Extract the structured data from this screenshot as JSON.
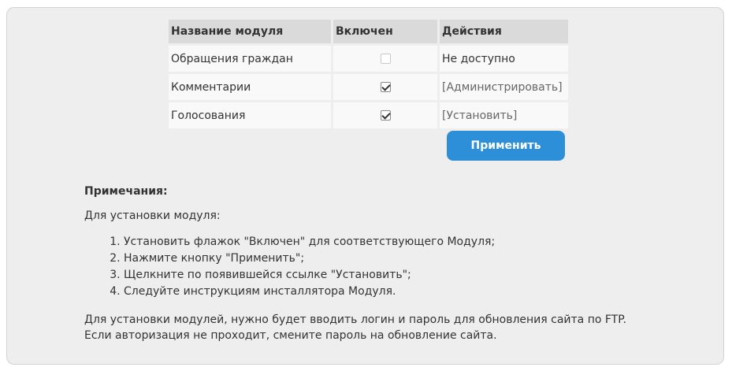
{
  "table": {
    "headers": [
      "Название модуля",
      "Включен",
      "Действия"
    ],
    "rows": [
      {
        "name": "Обращения граждан",
        "enabled": false,
        "disabled": true,
        "action": "Не доступно",
        "action_is_link": false
      },
      {
        "name": "Комментарии",
        "enabled": true,
        "disabled": false,
        "action": "[Администрировать]",
        "action_is_link": true
      },
      {
        "name": "Голосования",
        "enabled": true,
        "disabled": false,
        "action": "[Установить]",
        "action_is_link": true
      }
    ]
  },
  "apply_button": "Применить",
  "notes": {
    "title": "Примечания:",
    "intro": "Для установки модуля:",
    "steps": [
      "Установить флажок \"Включен\" для соответствующего Модуля;",
      "Нажмите кнопку \"Применить\";",
      "Щелкните по появившейся ссылке \"Установить\";",
      "Следуйте инструкциям инсталлятора Модуля."
    ],
    "footer_line1": "Для установки модулей, нужно будет вводить логин и пароль для обновления сайта по FTP.",
    "footer_line2": "Если авторизация не проходит, смените пароль на обновление сайта."
  },
  "colors": {
    "panel_bg": "#eeeeee",
    "header_bg": "#dadada",
    "cell_bg": "#f9f9f9",
    "button_bg": "#2d8fd8",
    "link": "#666666"
  }
}
